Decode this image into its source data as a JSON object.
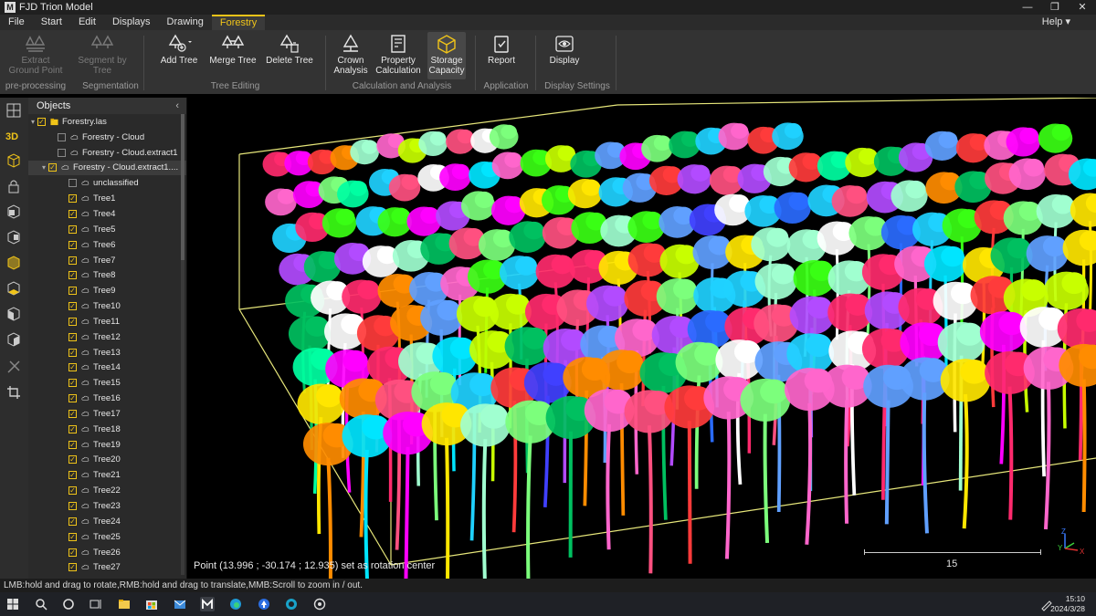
{
  "app": {
    "title": "FJD Trion Model",
    "logo_text": "M"
  },
  "menubar": {
    "items": [
      "File",
      "Start",
      "Edit",
      "Displays",
      "Drawing",
      "Forestry"
    ],
    "active": "Forestry",
    "help": "Help"
  },
  "ribbon": {
    "buttons": {
      "extract_ground": "Extract Ground Point",
      "segment_by_tree": "Segment by Tree",
      "add_tree": "Add Tree",
      "merge_tree": "Merge Tree",
      "delete_tree": "Delete Tree",
      "crown_analysis": "Crown Analysis",
      "property_calc": "Property Calculation",
      "storage_capacity": "Storage Capacity",
      "report": "Report",
      "display": "Display"
    },
    "groups": {
      "preprocessing": "pre-processing",
      "segmentation": "Segmentation",
      "tree_editing": "Tree Editing",
      "calc_analysis": "Calculation and Analysis",
      "application": "Application",
      "display_settings": "Display Settings"
    }
  },
  "toolstrip": {
    "view_3d": "3D"
  },
  "objects_panel": {
    "title": "Objects",
    "root": "Forestry.las",
    "clouds": [
      "Forestry - Cloud",
      "Forestry - Cloud.extract1",
      "Forestry - Cloud.extract1...."
    ],
    "unclassified": "unclassified",
    "trees": [
      "Tree1",
      "Tree4",
      "Tree5",
      "Tree6",
      "Tree7",
      "Tree8",
      "Tree9",
      "Tree10",
      "Tree11",
      "Tree12",
      "Tree13",
      "Tree14",
      "Tree15",
      "Tree16",
      "Tree17",
      "Tree18",
      "Tree19",
      "Tree20",
      "Tree21",
      "Tree22",
      "Tree23",
      "Tree24",
      "Tree25",
      "Tree26",
      "Tree27"
    ]
  },
  "viewport": {
    "status": "Point (13.996 ; -30.174 ; 12.935) set as rotation center",
    "scale_value": "15",
    "axes": {
      "x": "X",
      "y": "Y",
      "z": "Z"
    }
  },
  "statusbar": "LMB:hold and drag to rotate,RMB:hold and drag to translate,MMB:Scroll to zoom in / out.",
  "clock": {
    "time": "15:10",
    "date": "2024/3/28"
  },
  "colors": {
    "accent": "#f0c419",
    "box": "#e6e67a"
  }
}
